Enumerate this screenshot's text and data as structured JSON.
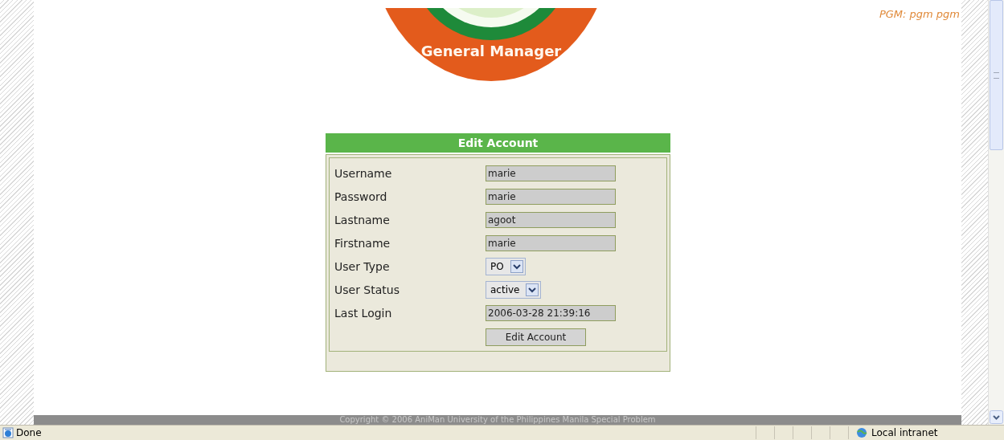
{
  "header": {
    "logo_text": "General Manager",
    "user": "PGM: pgm pgm"
  },
  "form": {
    "title": "Edit Account",
    "fields": [
      {
        "kind": "text",
        "label": "Username",
        "value": "marie"
      },
      {
        "kind": "text",
        "label": "Password",
        "value": "marie"
      },
      {
        "kind": "text",
        "label": "Lastname",
        "value": "agoot"
      },
      {
        "kind": "text",
        "label": "Firstname",
        "value": "marie"
      },
      {
        "kind": "select",
        "label": "User Type",
        "value": "PO"
      },
      {
        "kind": "select",
        "label": "User Status",
        "value": "active"
      },
      {
        "kind": "text",
        "label": "Last Login",
        "value": "2006-03-28 21:39:16"
      }
    ],
    "submit": "Edit Account"
  },
  "footer": "Copyright © 2006 AniMan University of the Philippines Manila Special Problem",
  "status_bar": {
    "status": "Done",
    "zone": "Local intranet"
  }
}
